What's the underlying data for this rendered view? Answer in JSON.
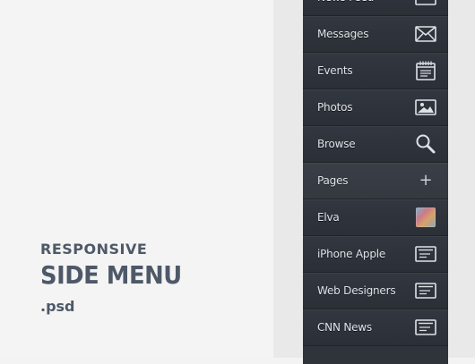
{
  "hero": {
    "subtitle": "RESPONSIVE",
    "title": "SIDE MENU",
    "extension": ".psd"
  },
  "menu": {
    "items": [
      {
        "label": "News Feed",
        "icon": "news-feed-icon"
      },
      {
        "label": "Messages",
        "icon": "envelope-icon"
      },
      {
        "label": "Events",
        "icon": "calendar-icon"
      },
      {
        "label": "Photos",
        "icon": "image-icon"
      },
      {
        "label": "Browse",
        "icon": "search-icon"
      },
      {
        "label": "Pages",
        "icon": "plus-icon",
        "active": true
      },
      {
        "label": "Elva",
        "icon": "avatar"
      },
      {
        "label": "iPhone Apple",
        "icon": "page-icon"
      },
      {
        "label": "Web Designers",
        "icon": "page-icon"
      },
      {
        "label": "CNN News",
        "icon": "page-icon"
      }
    ]
  },
  "colors": {
    "menu_bg": "#2f343b",
    "title": "#4e5968",
    "label": "#dfe3e8"
  }
}
